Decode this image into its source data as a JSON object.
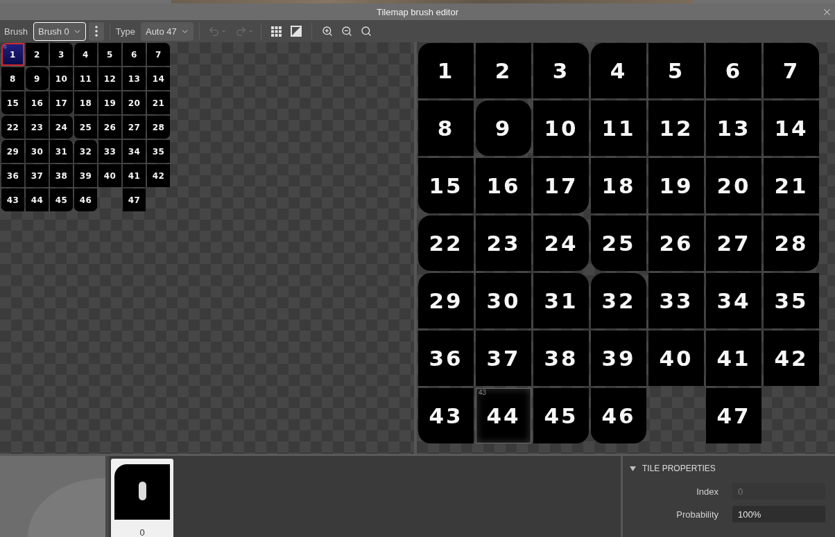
{
  "window": {
    "title": "Tilemap brush editor"
  },
  "toolbar": {
    "brush_label": "Brush",
    "brush_select": {
      "value": "Brush 0",
      "focused": true
    },
    "type_label": "Type",
    "type_select": {
      "value": "Auto 47",
      "focused": false
    },
    "undo": {
      "disabled": true
    },
    "redo": {
      "disabled": true
    }
  },
  "tileset": {
    "tiles": [
      {
        "kind": "topleft",
        "label": "1",
        "selected": true,
        "badge": "0"
      },
      {
        "kind": "square",
        "label": "2",
        "selected": false
      },
      {
        "kind": "topright",
        "label": "3",
        "selected": false
      },
      {
        "kind": "topleft",
        "label": "4",
        "selected": false
      },
      {
        "kind": "square",
        "label": "5",
        "selected": false
      },
      {
        "kind": "square",
        "label": "6",
        "selected": false
      },
      {
        "kind": "topright",
        "label": "7",
        "selected": false
      },
      {
        "kind": "square",
        "label": "8",
        "selected": false
      },
      {
        "kind": "round",
        "label": "9",
        "selected": false
      },
      {
        "kind": "square",
        "label": "10",
        "selected": false
      },
      {
        "kind": "square",
        "label": "11",
        "selected": false
      },
      {
        "kind": "square",
        "label": "12",
        "selected": false
      },
      {
        "kind": "square",
        "label": "13",
        "selected": false
      },
      {
        "kind": "square",
        "label": "14",
        "selected": false
      },
      {
        "kind": "bottomleft",
        "label": "15",
        "selected": false
      },
      {
        "kind": "square",
        "label": "16",
        "selected": false
      },
      {
        "kind": "bottomright",
        "label": "17",
        "selected": false
      },
      {
        "kind": "square",
        "label": "18",
        "selected": false
      },
      {
        "kind": "square",
        "label": "19",
        "selected": false
      },
      {
        "kind": "square",
        "label": "20",
        "selected": false
      },
      {
        "kind": "square",
        "label": "21",
        "selected": false
      },
      {
        "kind": "left",
        "label": "22",
        "selected": false
      },
      {
        "kind": "square",
        "label": "23",
        "selected": false
      },
      {
        "kind": "right",
        "label": "24",
        "selected": false
      },
      {
        "kind": "bottomleft",
        "label": "25",
        "selected": false
      },
      {
        "kind": "square",
        "label": "26",
        "selected": false
      },
      {
        "kind": "square",
        "label": "27",
        "selected": false
      },
      {
        "kind": "bottomright",
        "label": "28",
        "selected": false
      },
      {
        "kind": "topleft",
        "label": "29",
        "selected": false
      },
      {
        "kind": "square",
        "label": "30",
        "selected": false
      },
      {
        "kind": "topright",
        "label": "31",
        "selected": false
      },
      {
        "kind": "top",
        "label": "32",
        "selected": false
      },
      {
        "kind": "square",
        "label": "33",
        "selected": false
      },
      {
        "kind": "square",
        "label": "34",
        "selected": false
      },
      {
        "kind": "square",
        "label": "35",
        "selected": false
      },
      {
        "kind": "square",
        "label": "36",
        "selected": false
      },
      {
        "kind": "square",
        "label": "37",
        "selected": false
      },
      {
        "kind": "square",
        "label": "38",
        "selected": false
      },
      {
        "kind": "square",
        "label": "39",
        "selected": false
      },
      {
        "kind": "square",
        "label": "40",
        "selected": false
      },
      {
        "kind": "square",
        "label": "41",
        "selected": false
      },
      {
        "kind": "square",
        "label": "42",
        "selected": false
      },
      {
        "kind": "bottomleft",
        "label": "43",
        "selected": false
      },
      {
        "kind": "square",
        "label": "44",
        "selected": false
      },
      {
        "kind": "bottomright",
        "label": "45",
        "selected": false
      },
      {
        "kind": "bottom",
        "label": "46",
        "selected": false
      },
      {
        "kind": "empty"
      },
      {
        "kind": "square",
        "label": "47",
        "selected": false
      }
    ]
  },
  "tile_view": {
    "tiles": [
      {
        "kind": "topleft",
        "label": "1",
        "hovered": false
      },
      {
        "kind": "square",
        "label": "2",
        "hovered": false
      },
      {
        "kind": "topright",
        "label": "3",
        "hovered": false
      },
      {
        "kind": "topleft",
        "label": "4",
        "hovered": false
      },
      {
        "kind": "square",
        "label": "5",
        "hovered": false
      },
      {
        "kind": "square",
        "label": "6",
        "hovered": false
      },
      {
        "kind": "topright",
        "label": "7",
        "hovered": false
      },
      {
        "kind": "square",
        "label": "8",
        "hovered": false
      },
      {
        "kind": "round",
        "label": "9",
        "hovered": false
      },
      {
        "kind": "square",
        "label": "10",
        "hovered": false
      },
      {
        "kind": "square",
        "label": "11",
        "hovered": false
      },
      {
        "kind": "square",
        "label": "12",
        "hovered": false
      },
      {
        "kind": "square",
        "label": "13",
        "hovered": false
      },
      {
        "kind": "square",
        "label": "14",
        "hovered": false
      },
      {
        "kind": "bottomleft",
        "label": "15",
        "hovered": false
      },
      {
        "kind": "square",
        "label": "16",
        "hovered": false
      },
      {
        "kind": "bottomright",
        "label": "17",
        "hovered": false
      },
      {
        "kind": "square",
        "label": "18",
        "hovered": false
      },
      {
        "kind": "square",
        "label": "19",
        "hovered": false
      },
      {
        "kind": "square",
        "label": "20",
        "hovered": false
      },
      {
        "kind": "square",
        "label": "21",
        "hovered": false
      },
      {
        "kind": "left",
        "label": "22",
        "hovered": false
      },
      {
        "kind": "square",
        "label": "23",
        "hovered": false
      },
      {
        "kind": "right",
        "label": "24",
        "hovered": false
      },
      {
        "kind": "bottomleft",
        "label": "25",
        "hovered": false
      },
      {
        "kind": "square",
        "label": "26",
        "hovered": false
      },
      {
        "kind": "square",
        "label": "27",
        "hovered": false
      },
      {
        "kind": "bottomright",
        "label": "28",
        "hovered": false
      },
      {
        "kind": "topleft",
        "label": "29",
        "hovered": false
      },
      {
        "kind": "square",
        "label": "30",
        "hovered": false
      },
      {
        "kind": "topright",
        "label": "31",
        "hovered": false
      },
      {
        "kind": "top",
        "label": "32",
        "hovered": false
      },
      {
        "kind": "square",
        "label": "33",
        "hovered": false
      },
      {
        "kind": "square",
        "label": "34",
        "hovered": false
      },
      {
        "kind": "square",
        "label": "35",
        "hovered": false
      },
      {
        "kind": "square",
        "label": "36",
        "hovered": false
      },
      {
        "kind": "square",
        "label": "37",
        "hovered": false
      },
      {
        "kind": "square",
        "label": "38",
        "hovered": false
      },
      {
        "kind": "square",
        "label": "39",
        "hovered": false
      },
      {
        "kind": "square",
        "label": "40",
        "hovered": false
      },
      {
        "kind": "square",
        "label": "41",
        "hovered": false
      },
      {
        "kind": "square",
        "label": "42",
        "hovered": false
      },
      {
        "kind": "bottomleft",
        "label": "43",
        "hovered": false
      },
      {
        "kind": "square",
        "label": "44",
        "hovered": true,
        "badge": "43"
      },
      {
        "kind": "bottomright",
        "label": "45",
        "hovered": false
      },
      {
        "kind": "bottom",
        "label": "46",
        "hovered": false
      },
      {
        "kind": "empty"
      },
      {
        "kind": "square",
        "label": "47",
        "hovered": false
      }
    ]
  },
  "tile_list": {
    "tiles": [
      {
        "kind": "topleft",
        "label": "0",
        "selected": true
      }
    ]
  },
  "tile_properties": {
    "title": "TILE PROPERTIES",
    "expanded": true,
    "fields": [
      {
        "label": "Index",
        "value": "0",
        "disabled": true
      },
      {
        "label": "Probability",
        "value": "100%",
        "disabled": false
      }
    ]
  }
}
